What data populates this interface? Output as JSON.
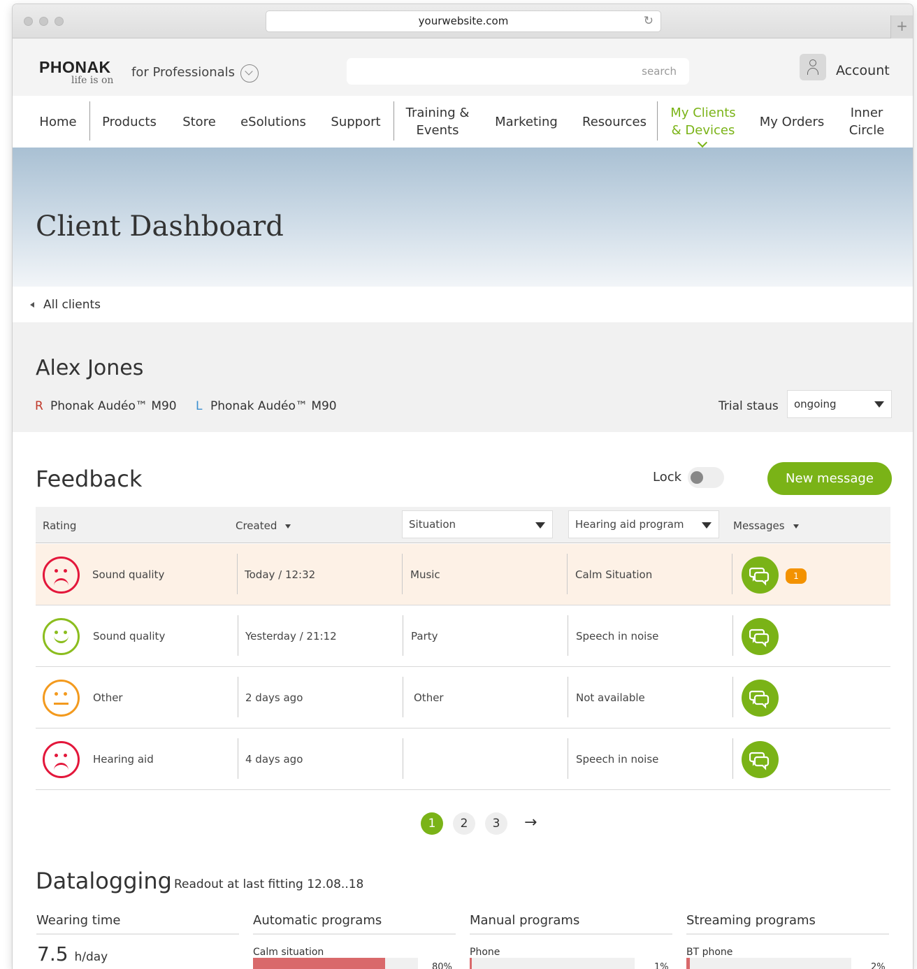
{
  "browser": {
    "url": "yourwebsite.com"
  },
  "header": {
    "logo": "PHONAK",
    "tagline": "life is on",
    "portal": "for Professionals",
    "search_placeholder": "search",
    "account": "Account"
  },
  "nav": {
    "items": [
      {
        "label": "Home"
      },
      {
        "label": "Products"
      },
      {
        "label": "Store"
      },
      {
        "label": "eSolutions"
      },
      {
        "label": "Support"
      },
      {
        "label": "Training &\nEvents"
      },
      {
        "label": "Marketing"
      },
      {
        "label": "Resources"
      },
      {
        "label": "My Clients\n& Devices"
      },
      {
        "label": "My Orders"
      },
      {
        "label": "Inner\nCircle"
      }
    ],
    "active_color": "#7ab317"
  },
  "hero": {
    "title": "Client Dashboard"
  },
  "breadcrumb": {
    "back": "All clients"
  },
  "client": {
    "name": "Alex Jones",
    "right_tag": "R",
    "right_device": "Phonak Audéo™ M90",
    "left_tag": "L",
    "left_device": "Phonak Audéo™ M90",
    "trial_label": "Trial staus",
    "trial_value": "ongoing"
  },
  "feedback": {
    "title": "Feedback",
    "lock_label": "Lock",
    "new_message": "New message",
    "columns": {
      "rating": "Rating",
      "created": "Created",
      "situation": "Situation",
      "program": "Hearing aid program",
      "messages": "Messages"
    },
    "rows": [
      {
        "rating": "Sound quality",
        "face": "sad-red",
        "created": "Today / 12:32",
        "situation": "Music",
        "program": "Calm Situation",
        "badge": "1"
      },
      {
        "rating": "Sound quality",
        "face": "happy-green",
        "created": "Yesterday / 21:12",
        "situation": "Party",
        "program": "Speech in noise",
        "badge": ""
      },
      {
        "rating": "Other",
        "face": "neutral-orange",
        "created": "2 days ago",
        "situation": "Other",
        "program": "Not available",
        "badge": ""
      },
      {
        "rating": "Hearing aid",
        "face": "sad-red",
        "created": "4 days ago",
        "situation": "",
        "program": "Speech in noise",
        "badge": ""
      }
    ],
    "pages": [
      "1",
      "2",
      "3"
    ],
    "next": "→"
  },
  "datalogging": {
    "title": "Datalogging",
    "subtitle": "Readout at last fitting 12.08..18",
    "wearing": {
      "title": "Wearing time",
      "value": "7.5",
      "unit": "h/day"
    },
    "automatic": {
      "title": "Automatic programs",
      "item": "Calm situation",
      "pct": "80%",
      "fraction": 0.8
    },
    "manual": {
      "title": "Manual programs",
      "item": "Phone",
      "pct": "1%",
      "fraction": 0.01
    },
    "streaming": {
      "title": "Streaming programs",
      "item": "BT phone",
      "pct": "2%",
      "fraction": 0.02
    }
  }
}
